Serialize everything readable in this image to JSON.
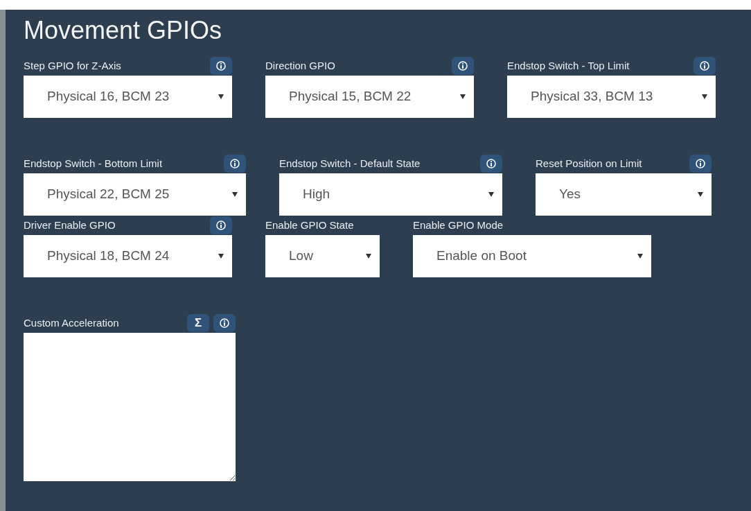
{
  "title": "Movement GPIOs",
  "rows": [
    [
      {
        "kind": "select",
        "label": "Step GPIO for Z-Axis",
        "value": "Physical 16, BCM 23",
        "buttons": [
          {
            "kind": "info"
          }
        ]
      },
      {
        "kind": "select",
        "label": "Direction GPIO",
        "value": "Physical 15, BCM 22",
        "buttons": [
          {
            "kind": "info"
          }
        ]
      },
      {
        "kind": "select",
        "label": "Endstop Switch - Top Limit",
        "value": "Physical 33, BCM 13",
        "buttons": [
          {
            "kind": "info"
          }
        ]
      }
    ],
    [
      {
        "kind": "select",
        "label": "Endstop Switch - Bottom Limit",
        "value": "Physical 22, BCM 25",
        "buttons": [
          {
            "kind": "info"
          }
        ]
      },
      {
        "kind": "select",
        "label": "Endstop Switch - Default State",
        "value": "High",
        "buttons": [
          {
            "kind": "info"
          }
        ]
      },
      {
        "kind": "select",
        "label": "Reset Position on Limit",
        "value": "Yes",
        "buttons": [
          {
            "kind": "info"
          }
        ]
      }
    ],
    [
      {
        "kind": "select",
        "label": "Driver Enable GPIO",
        "value": "Physical 18, BCM 24",
        "buttons": [
          {
            "kind": "info"
          }
        ]
      },
      {
        "kind": "select",
        "label": "Enable GPIO State",
        "value": "Low"
      },
      {
        "kind": "select",
        "label": "Enable GPIO Mode",
        "value": "Enable on Boot"
      }
    ],
    [
      {
        "kind": "textarea",
        "label": "Custom Acceleration",
        "buttons": [
          {
            "kind": "formula",
            "text": "Σ"
          },
          {
            "kind": "info"
          }
        ]
      }
    ]
  ]
}
